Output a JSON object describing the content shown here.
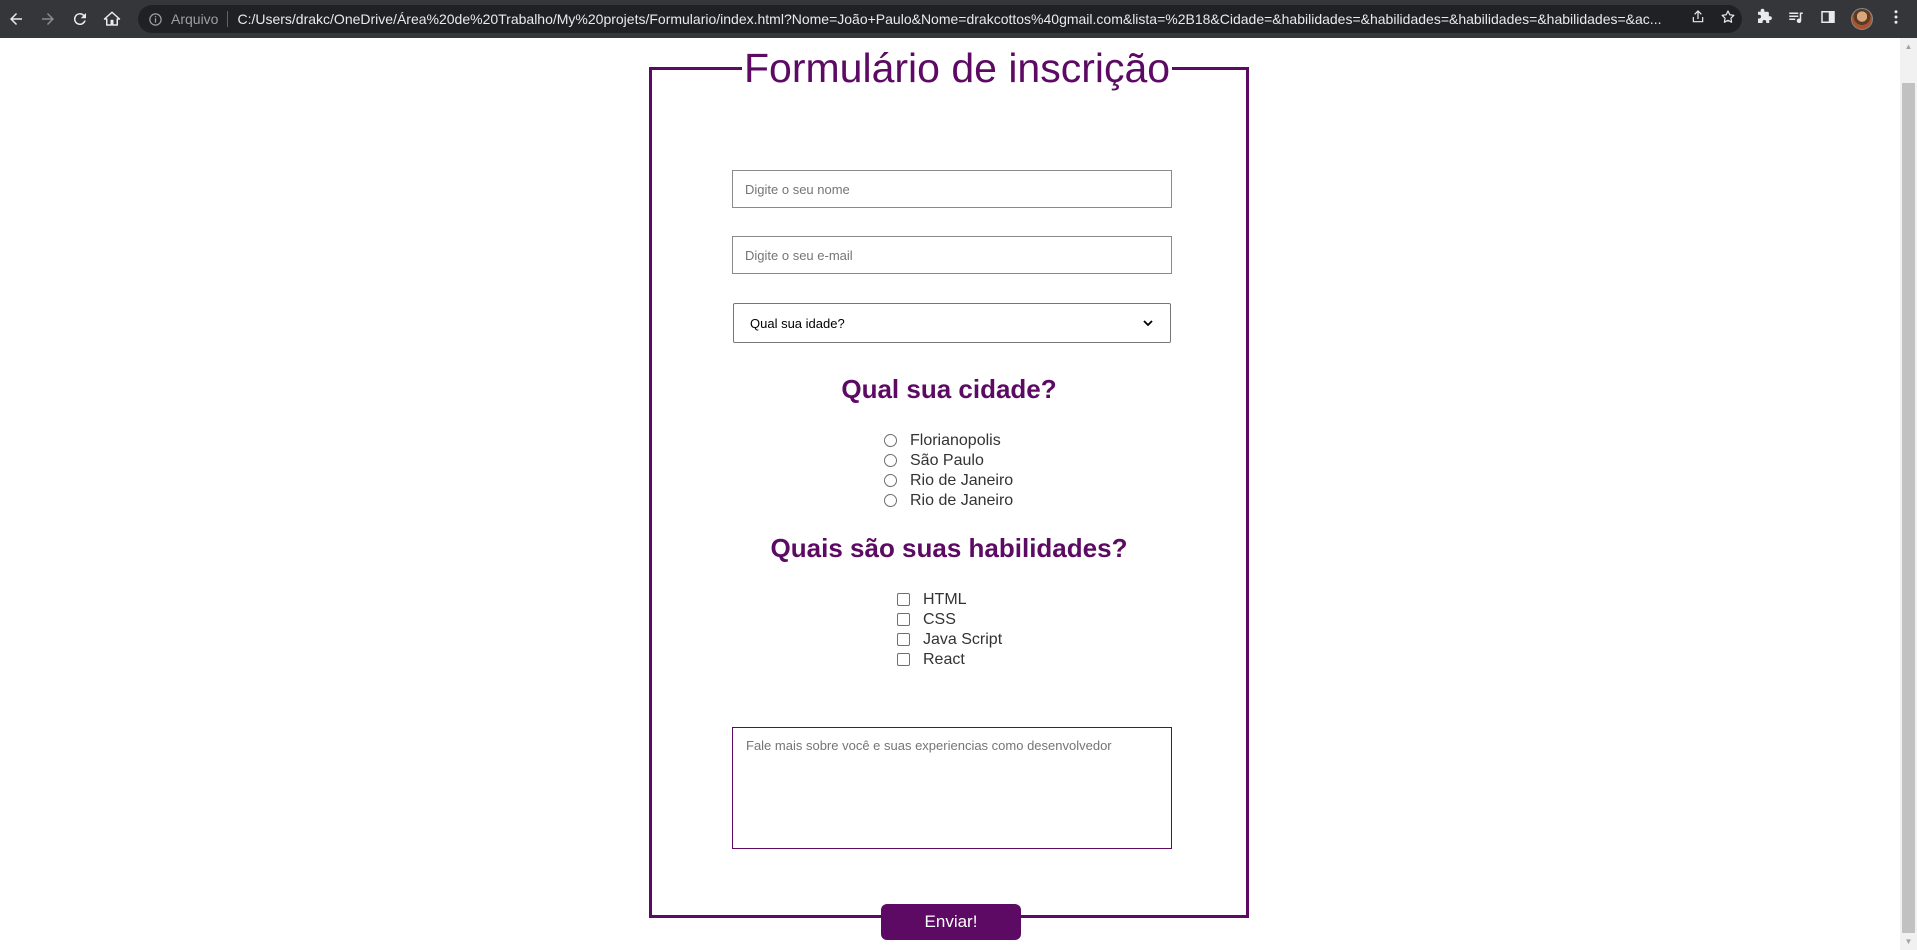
{
  "browser": {
    "omnibox_label": "Arquivo",
    "url": "C:/Users/drakc/OneDrive/Área%20de%20Trabalho/My%20projets/Formulario/index.html?Nome=João+Paulo&Nome=drakcottos%40gmail.com&lista=%2B18&Cidade=&habilidades=&habilidades=&habilidades=&habilidades=&ac..."
  },
  "form": {
    "title": "Formulário de inscrição",
    "name_placeholder": "Digite o seu nome",
    "email_placeholder": "Digite o seu e-mail",
    "age_select": {
      "selected": "Qual sua idade?"
    },
    "city": {
      "title": "Qual sua cidade?",
      "options": [
        "Florianopolis",
        "São Paulo",
        "Rio de Janeiro",
        "Rio de Janeiro"
      ]
    },
    "skills": {
      "title": "Quais são suas habilidades?",
      "options": [
        "HTML",
        "CSS",
        "Java Script",
        "React"
      ]
    },
    "about_placeholder": "Fale mais sobre você e suas experiencias como desenvolvedor",
    "submit_label": "Enviar!"
  },
  "colors": {
    "accent": "#5c0a63",
    "chrome_bg": "#35363a",
    "omnibox_bg": "#202124"
  }
}
